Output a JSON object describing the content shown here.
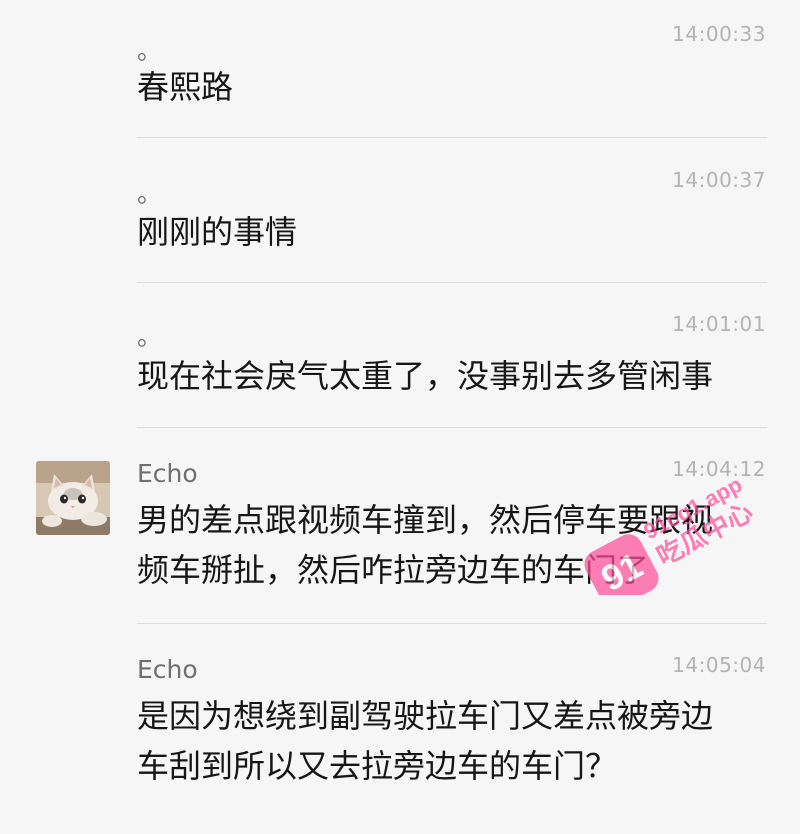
{
  "messages": [
    {
      "sender": "。",
      "time": "14:00:33",
      "lines": [
        "春熙路"
      ]
    },
    {
      "sender": "。",
      "time": "14:00:37",
      "lines": [
        "刚刚的事情"
      ]
    },
    {
      "sender": "。",
      "time": "14:01:01",
      "lines": [
        "现在社会戾气太重了，没事别去多管闲事"
      ]
    },
    {
      "sender": "Echo",
      "time": "14:04:12",
      "lines": [
        "男的差点跟视频车撞到，然后停车要跟视",
        "频车掰扯，然后咋拉旁边车的车门了"
      ]
    },
    {
      "sender": "Echo",
      "time": "14:05:04",
      "lines": [
        "是因为想绕到副驾驶拉车门又差点被旁边",
        "车刮到所以又去拉旁边车的车门？"
      ]
    }
  ],
  "avatar": {
    "icon": "cat-avatar-icon"
  },
  "watermark": {
    "badge": "91",
    "line1": "91cg1.app",
    "line2": "吃瓜中心",
    "color": "#ff4f9a"
  }
}
